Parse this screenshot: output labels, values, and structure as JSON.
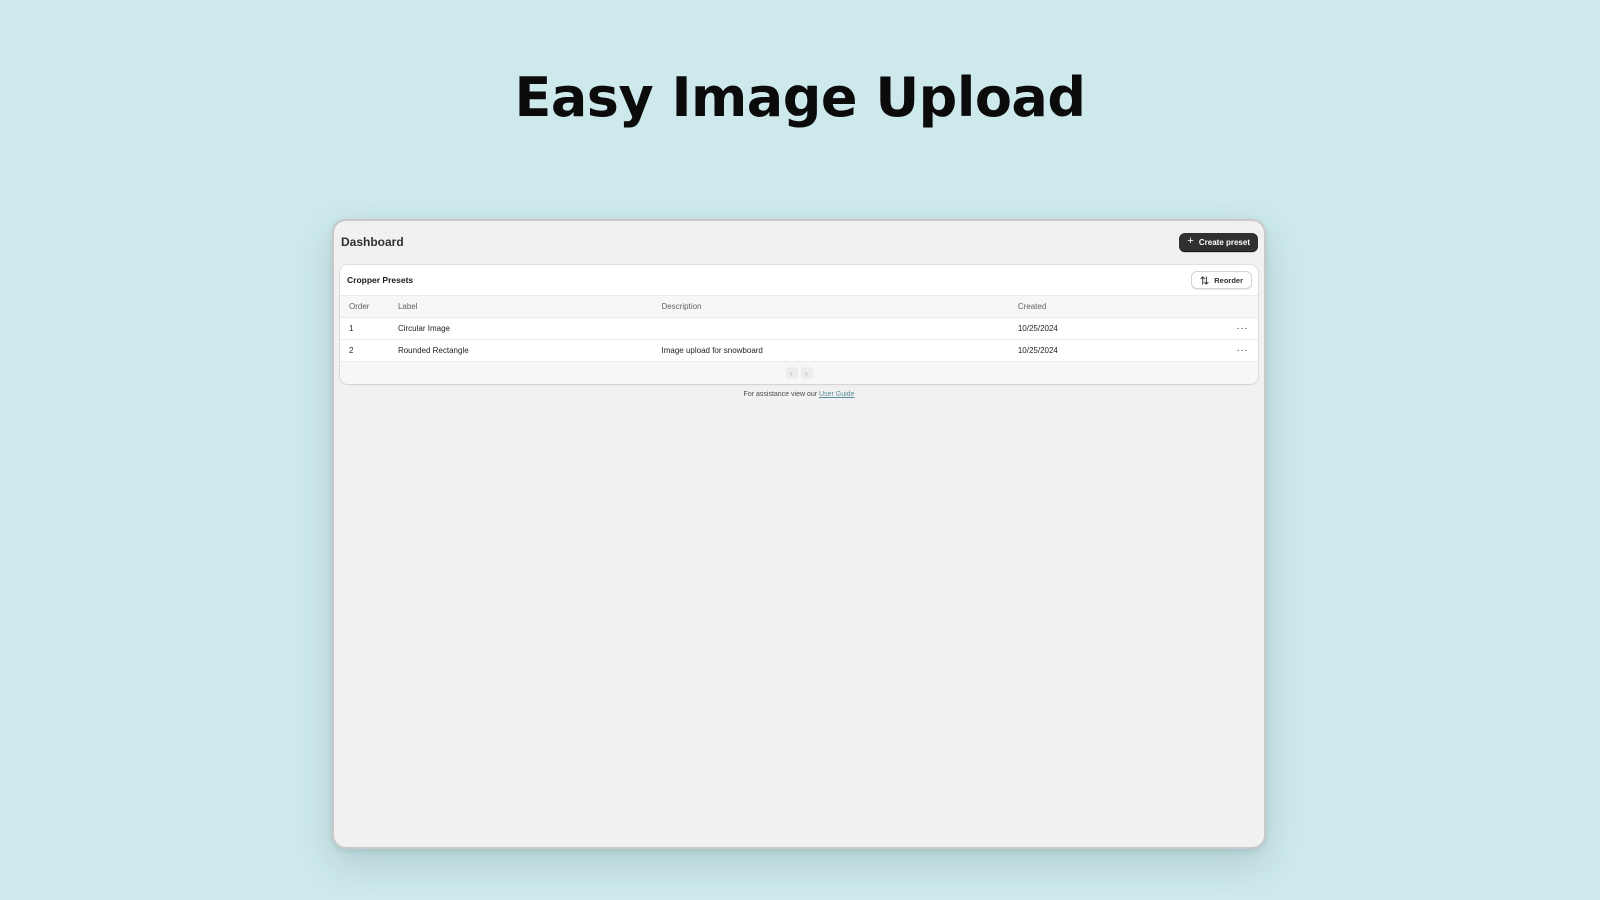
{
  "hero": {
    "title": "Easy Image Upload"
  },
  "app": {
    "page_title": "Dashboard",
    "create_button": {
      "icon": "plus-icon",
      "label": "Create preset"
    }
  },
  "card": {
    "title": "Cropper Presets",
    "reorder_button": {
      "icon": "sort-arrows-icon",
      "label": "Reorder"
    }
  },
  "table": {
    "columns": [
      "Order",
      "Label",
      "Description",
      "Created"
    ],
    "rows": [
      {
        "order": "1",
        "label": "Circular Image",
        "description": "",
        "created": "10/25/2024",
        "actions": "···"
      },
      {
        "order": "2",
        "label": "Rounded Rectangle",
        "description": "Image upload for snowboard",
        "created": "10/25/2024",
        "actions": "···"
      }
    ]
  },
  "pagination": {
    "prev_icon": "chevron-left-icon",
    "next_icon": "chevron-right-icon",
    "prev_glyph": "‹",
    "next_glyph": "›"
  },
  "footer": {
    "text": "For assistance view our",
    "link_label": "User Guide"
  },
  "colors": {
    "background": "#cde9ec",
    "window": "#f1f1f1",
    "primary_button": "#303030",
    "link": "#5a8f9a"
  }
}
